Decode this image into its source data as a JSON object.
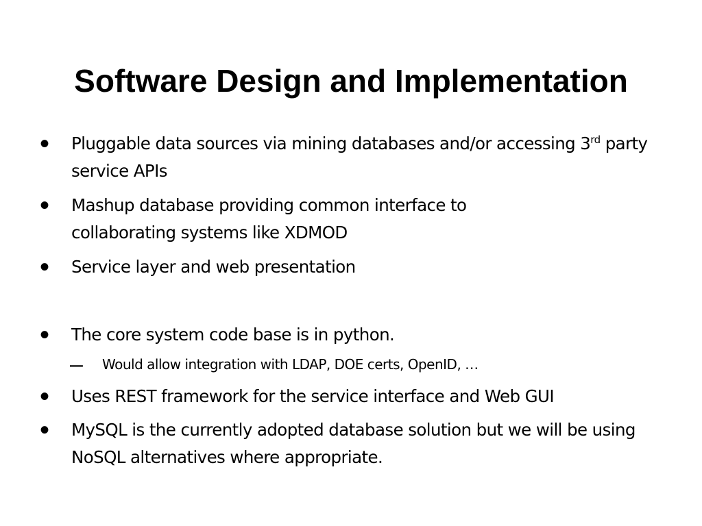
{
  "slide": {
    "title": "Software Design and Implementation",
    "bullet_symbol": "•",
    "dash_symbol": "–",
    "bullets": [
      {
        "text": "Pluggable data sources via mining databases and/or accessing 3",
        "sup": "rd",
        "text_after": " party service APIs"
      },
      {
        "text": "Mashup database providing common interface to collaborating systems like XDMOD"
      },
      {
        "text": "Service layer and web presentation"
      },
      {
        "text": "The core system code base is in python."
      },
      {
        "text": "Uses REST framework for the service interface and Web GUI"
      },
      {
        "text": "MySQL is the currently adopted database solution but we will be using NoSQL alternatives where appropriate."
      }
    ],
    "sub_bullets": [
      {
        "text": "Would allow integration with LDAP, DOE certs, OpenID, …"
      }
    ]
  }
}
